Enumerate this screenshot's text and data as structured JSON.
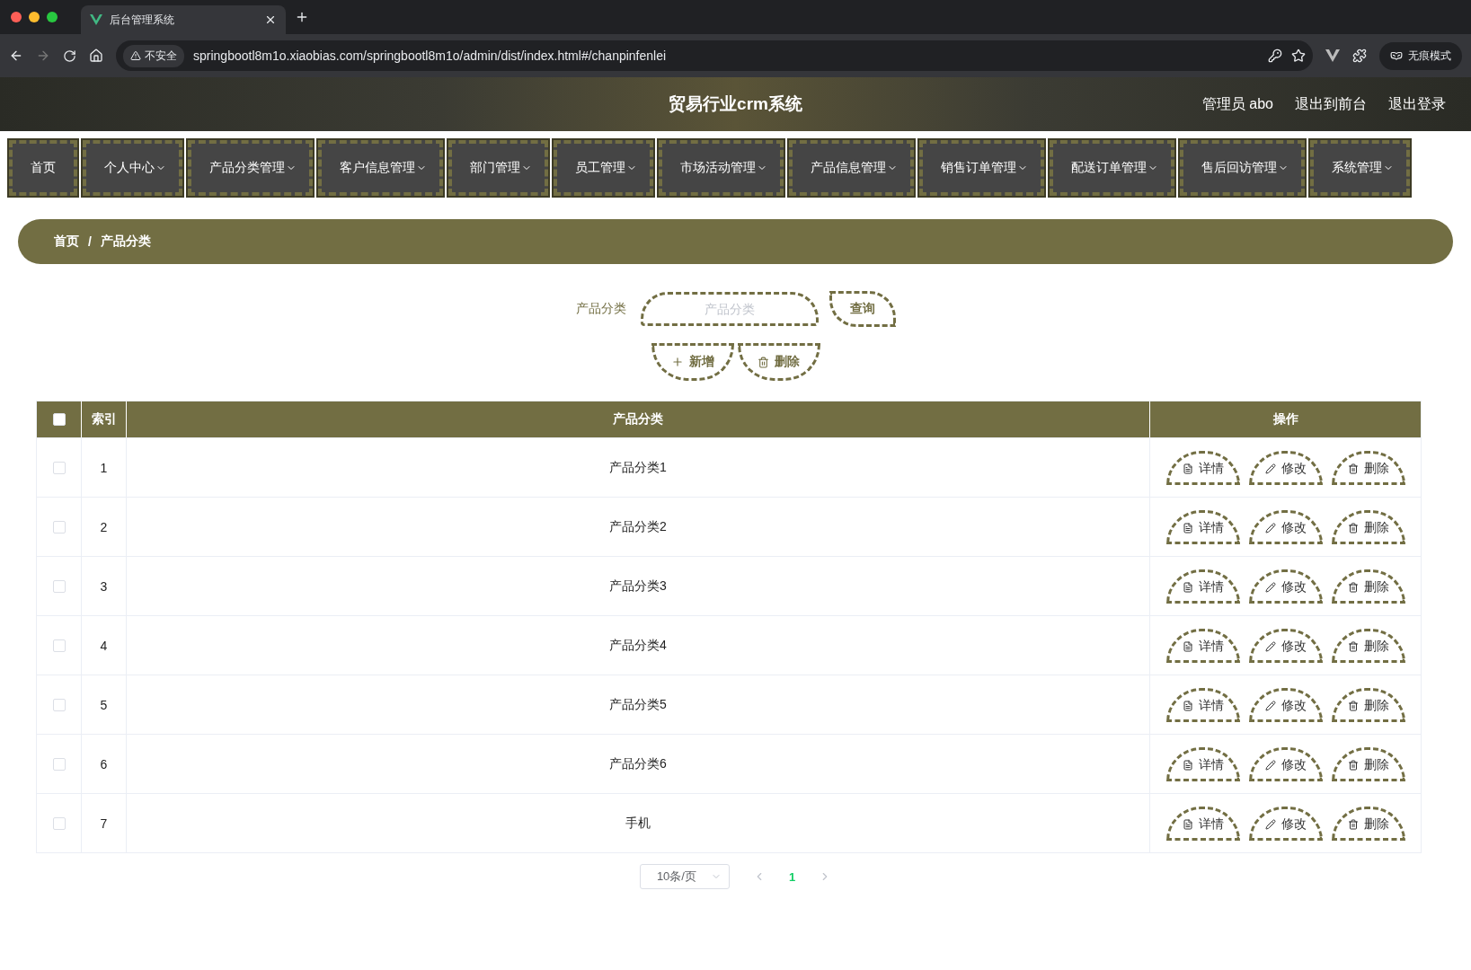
{
  "browser": {
    "tab_title": "后台管理系统",
    "security": "不安全",
    "url": "springbootl8m1o.xiaobias.com/springbootl8m1o/admin/dist/index.html#/chanpinfenlei",
    "profile": "无痕模式"
  },
  "header": {
    "title": "贸易行业crm系统",
    "links": [
      "管理员 abo",
      "退出到前台",
      "退出登录"
    ]
  },
  "nav": [
    {
      "label": "首页",
      "has_menu": false
    },
    {
      "label": "个人中心",
      "has_menu": true
    },
    {
      "label": "产品分类管理",
      "has_menu": true
    },
    {
      "label": "客户信息管理",
      "has_menu": true
    },
    {
      "label": "部门管理",
      "has_menu": true
    },
    {
      "label": "员工管理",
      "has_menu": true
    },
    {
      "label": "市场活动管理",
      "has_menu": true
    },
    {
      "label": "产品信息管理",
      "has_menu": true
    },
    {
      "label": "销售订单管理",
      "has_menu": true
    },
    {
      "label": "配送订单管理",
      "has_menu": true
    },
    {
      "label": "售后回访管理",
      "has_menu": true
    },
    {
      "label": "系统管理",
      "has_menu": true
    }
  ],
  "breadcrumb": {
    "items": [
      "首页",
      "产品分类"
    ],
    "separator": "/"
  },
  "search": {
    "label": "产品分类",
    "placeholder": "产品分类",
    "button": "查询"
  },
  "actions": [
    "新增",
    "删除"
  ],
  "table": {
    "select_all_checked": false,
    "columns": [
      "索引",
      "产品分类",
      "操作"
    ],
    "rows": [
      {
        "index": "1",
        "name": "产品分类1",
        "checked": false,
        "actions": [
          "详情",
          "修改",
          "删除"
        ]
      },
      {
        "index": "2",
        "name": "产品分类2",
        "checked": false,
        "actions": [
          "详情",
          "修改",
          "删除"
        ]
      },
      {
        "index": "3",
        "name": "产品分类3",
        "checked": false,
        "actions": [
          "详情",
          "修改",
          "删除"
        ]
      },
      {
        "index": "4",
        "name": "产品分类4",
        "checked": false,
        "actions": [
          "详情",
          "修改",
          "删除"
        ]
      },
      {
        "index": "5",
        "name": "产品分类5",
        "checked": false,
        "actions": [
          "详情",
          "修改",
          "删除"
        ]
      },
      {
        "index": "6",
        "name": "产品分类6",
        "checked": false,
        "actions": [
          "详情",
          "修改",
          "删除"
        ]
      },
      {
        "index": "7",
        "name": "手机",
        "checked": false,
        "actions": [
          "详情",
          "修改",
          "删除"
        ]
      }
    ]
  },
  "pagination": {
    "page_size": "10条/页",
    "pages": [
      {
        "label": "1",
        "selected": true
      }
    ]
  }
}
